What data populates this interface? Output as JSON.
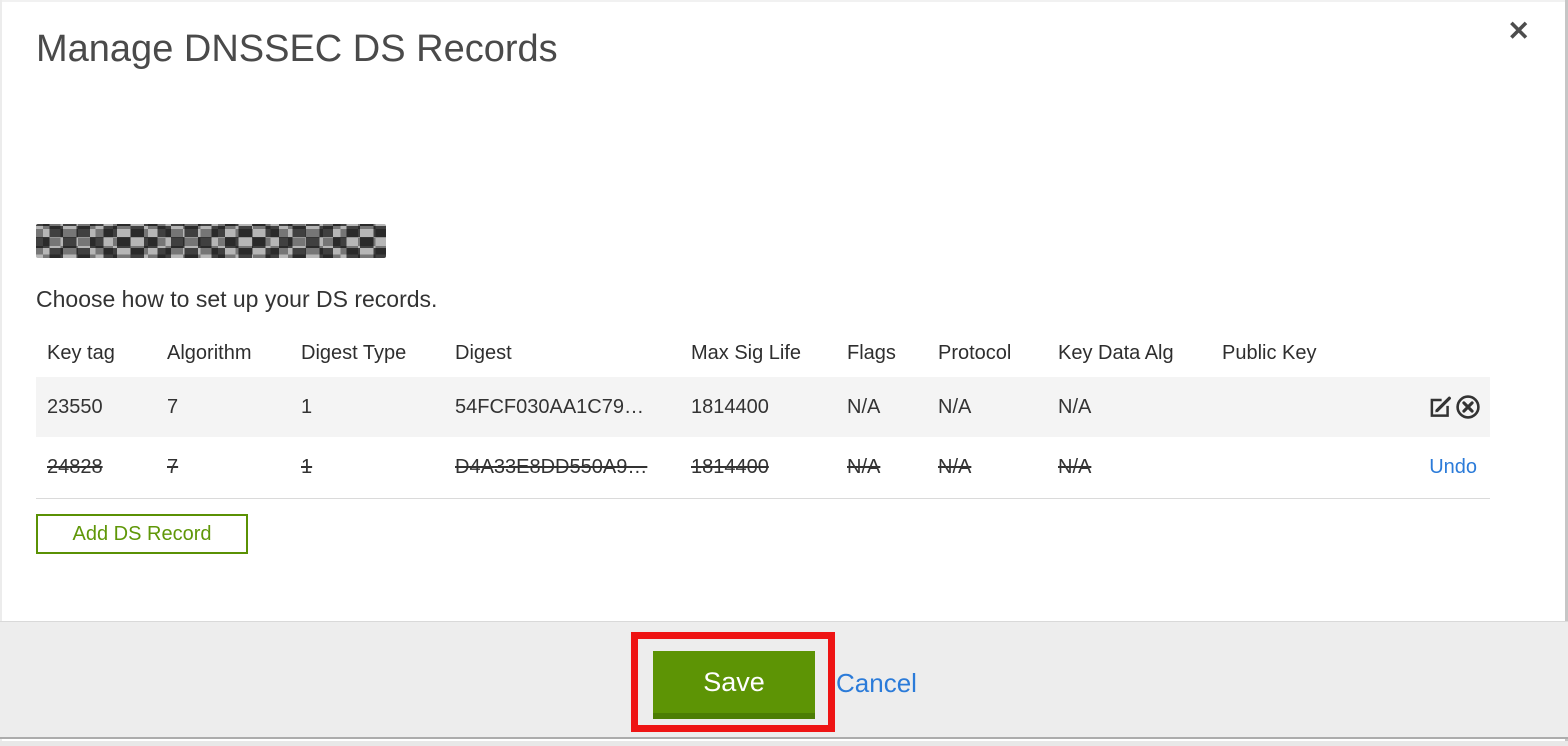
{
  "dialog": {
    "title": "Manage DNSSEC DS Records",
    "close_glyph": "✕",
    "intro": "Choose how to set up your DS records."
  },
  "table": {
    "columns": [
      "Key tag",
      "Algorithm",
      "Digest Type",
      "Digest",
      "Max Sig Life",
      "Flags",
      "Protocol",
      "Key Data Alg",
      "Public Key"
    ],
    "rows": [
      {
        "cells": [
          "23550",
          "7",
          "1",
          "54FCF030AA1C79…",
          "1814400",
          "N/A",
          "N/A",
          "N/A"
        ],
        "deleted": false,
        "actions": [
          "edit-icon",
          "delete-icon"
        ]
      },
      {
        "cells": [
          "24828",
          "7",
          "1",
          "D4A33E8DD550A9…",
          "1814400",
          "N/A",
          "N/A",
          "N/A"
        ],
        "deleted": true,
        "action_label": "Undo"
      }
    ]
  },
  "buttons": {
    "add_label": "Add DS Record",
    "save_label": "Save",
    "cancel_label": "Cancel"
  },
  "colors": {
    "accent_green": "#5d9405",
    "accent_green_dark": "#4c7d04",
    "outline_green": "#5a9104",
    "link_blue": "#2b7bd9",
    "annotation_red": "#ee1414",
    "row_gray": "#f4f4f4",
    "footer_gray": "#ededed"
  }
}
